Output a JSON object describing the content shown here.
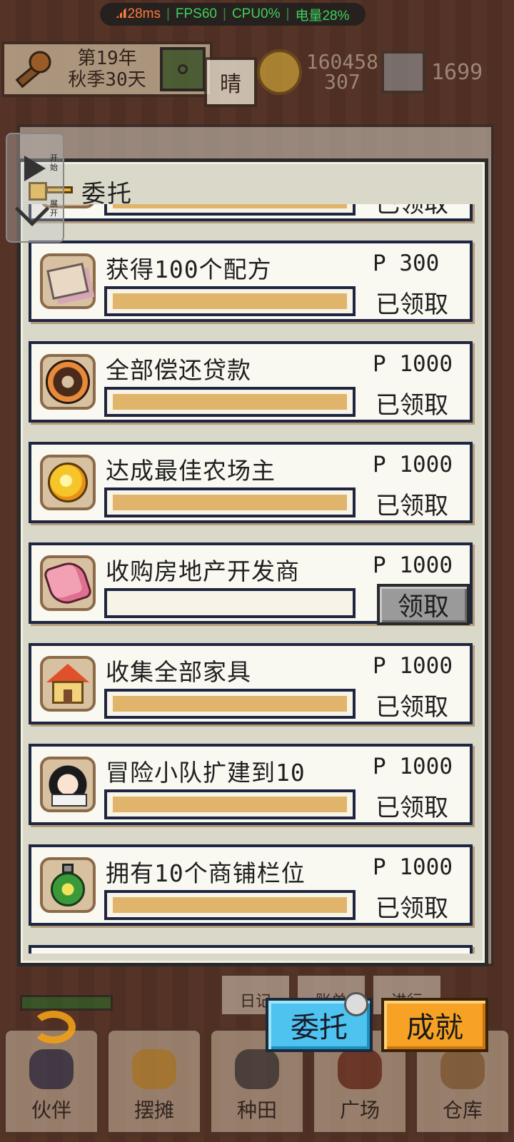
{
  "perf": {
    "ping": "28ms",
    "fps": "FPS60",
    "cpu": "CPU0%",
    "battery": "电量28%"
  },
  "hud": {
    "year": "第19年",
    "season_day": "秋季30天",
    "weather": "晴",
    "gold_line1": "160458",
    "gold_line2": "307",
    "gems": "1699"
  },
  "float_widget": {
    "start": "开始",
    "expand": "展开"
  },
  "dialog": {
    "title": "委托",
    "tasks": [
      {
        "name": "",
        "reward": "",
        "status": "已领取",
        "progress": 1.0,
        "icon": "partial-icon"
      },
      {
        "name": "获得100个配方",
        "reward": "P 300",
        "status": "已领取",
        "progress": 1.0,
        "icon": "recipe-icon"
      },
      {
        "name": "全部偿还贷款",
        "reward": "P 1000",
        "status": "已领取",
        "progress": 1.0,
        "icon": "donut-icon"
      },
      {
        "name": "达成最佳农场主",
        "reward": "P 1000",
        "status": "已领取",
        "progress": 1.0,
        "icon": "orange-icon"
      },
      {
        "name": "收购房地产开发商",
        "reward": "P 1000",
        "button": "领取",
        "progress": 0.0,
        "icon": "meat-icon"
      },
      {
        "name": "收集全部家具",
        "reward": "P 1000",
        "status": "已领取",
        "progress": 1.0,
        "icon": "house-icon"
      },
      {
        "name": "冒险小队扩建到10",
        "reward": "P 1000",
        "status": "已领取",
        "progress": 1.0,
        "icon": "girl-icon"
      },
      {
        "name": "拥有10个商铺栏位",
        "reward": "P 1000",
        "status": "已领取",
        "progress": 1.0,
        "icon": "potion-icon"
      }
    ]
  },
  "buttons": {
    "commission": "委托",
    "achievement": "成就"
  },
  "mini_tabs": [
    "日记",
    "账单",
    "进行"
  ],
  "nav": [
    "伙伴",
    "摆摊",
    "种田",
    "广场",
    "仓库"
  ]
}
